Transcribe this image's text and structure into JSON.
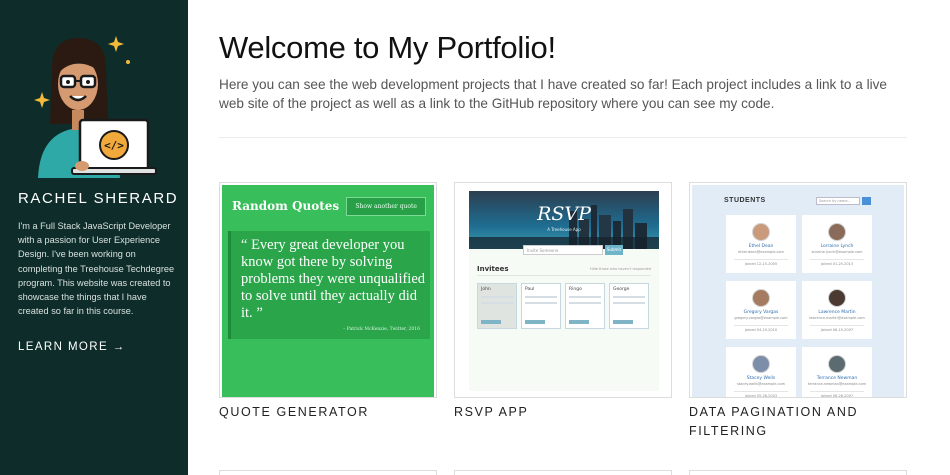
{
  "sidebar": {
    "name": "RACHEL SHERARD",
    "bio": "I'm a Full Stack JavaScript Developer with a passion for User Experience Design. I've been working on completing the Treehouse Techdegree program. This website was created to showcase the things that I have created so far in this course.",
    "learn_more": "LEARN MORE →"
  },
  "main": {
    "title": "Welcome to My Portfolio!",
    "intro": "Here you can see the web development projects that I have created so far! Each project includes a link to a live web site of the project as well as a link to the GitHub repository where you can see my code."
  },
  "projects": [
    {
      "title": "QUOTE GENERATOR",
      "preview": {
        "heading": "Random Quotes",
        "button": "Show another quote",
        "quote_open": "“",
        "quote": "Every great developer you know got there by solving problems they were unqualified to solve until they actually did it.",
        "quote_close": "”",
        "source": "– Patrick McKenzie, Twitter, 2016"
      }
    },
    {
      "title": "RSVP APP",
      "preview": {
        "heading": "RSVP",
        "subheading": "A Treehouse App",
        "input_placeholder": "Invite Someone",
        "submit": "Submit",
        "invitees_label": "Invitees",
        "hide_label": "Hide those who haven't responded",
        "guests": [
          "John",
          "Paul",
          "Ringo",
          "George"
        ]
      }
    },
    {
      "title": "DATA PAGINATION AND FILTERING",
      "preview": {
        "heading": "STUDENTS",
        "search_placeholder": "Search by name...",
        "students": [
          {
            "name": "Ethel Dean",
            "email": "ethel.dean@example.com",
            "date": "Joined 12-15-2005"
          },
          {
            "name": "Lorraine Lynch",
            "email": "lorraine.lynch@example.com",
            "date": "Joined 01-25-2013"
          },
          {
            "name": "Gregory Vargas",
            "email": "gregory.vargas@example.com",
            "date": "Joined 04-19-2010"
          },
          {
            "name": "Lawrence Martin",
            "email": "lawrence.martin@example.com",
            "date": "Joined 06-15-2007"
          },
          {
            "name": "Stacey Wells",
            "email": "stacey.wells@example.com",
            "date": "Joined 05-28-2003"
          },
          {
            "name": "Terrance Newman",
            "email": "terrance.newman@example.com",
            "date": "Joined 06-26-2007"
          }
        ]
      }
    }
  ],
  "colors": {
    "sidebar_bg": "#0e2d2a",
    "quote_green": "#38be5a",
    "students_bg": "#e2ecf7"
  },
  "icons": {
    "avatar": "developer-avatar-illustration",
    "laptop_logo": "code-brackets-icon",
    "sparkle": "sparkle-icon"
  }
}
